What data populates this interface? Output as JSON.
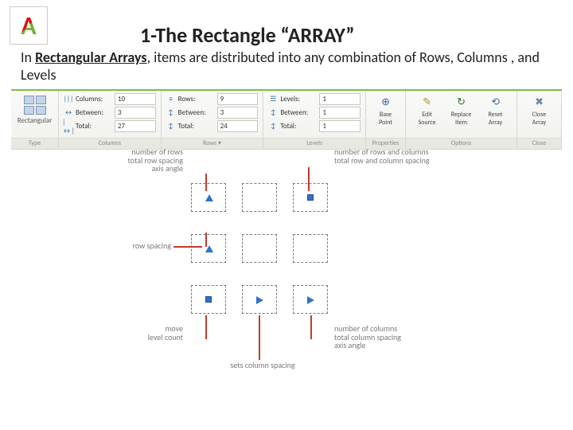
{
  "header": {
    "title": "1-The Rectangle “ARRAY”",
    "desc_prefix": "In ",
    "desc_bold": "Rectangular Arrays",
    "desc_rest": ", items are distributed into any combination of Rows, Columns , and Levels"
  },
  "ribbon": {
    "type": {
      "label": "Rectangular",
      "panel": "Type"
    },
    "columns": {
      "panel": "Columns",
      "rows": [
        {
          "icon": "|||",
          "label": "Columns:",
          "value": "10"
        },
        {
          "icon": "↔",
          "label": "Between:",
          "value": "3"
        },
        {
          "icon": "|↔|",
          "label": "Total:",
          "value": "27"
        }
      ]
    },
    "rowsP": {
      "panel": "Rows ▾",
      "rows": [
        {
          "icon": "≡",
          "label": "Rows:",
          "value": "9"
        },
        {
          "icon": "↕",
          "label": "Between:",
          "value": "3"
        },
        {
          "icon": "↕",
          "label": "Total:",
          "value": "24"
        }
      ]
    },
    "levels": {
      "panel": "Levels",
      "rows": [
        {
          "icon": "☰",
          "label": "Levels:",
          "value": "1"
        },
        {
          "icon": "↕",
          "label": "Between:",
          "value": "1"
        },
        {
          "icon": "↕",
          "label": "Total:",
          "value": "1"
        }
      ]
    },
    "props": {
      "panel": "Properties",
      "items": [
        {
          "icon": "⊕",
          "label1": "Base",
          "label2": "Point"
        }
      ]
    },
    "options": {
      "panel": "Options",
      "items": [
        {
          "icon": "✎",
          "label1": "Edit",
          "label2": "Source"
        },
        {
          "icon": "↻",
          "label1": "Replace",
          "label2": "Item"
        },
        {
          "icon": "⟲",
          "label1": "Reset",
          "label2": "Array"
        }
      ]
    },
    "close": {
      "panel": "Close",
      "items": [
        {
          "icon": "✖",
          "label1": "Close",
          "label2": "Array"
        }
      ]
    }
  },
  "annotations": {
    "top_left": "number of rows\ntotal row spacing\naxis angle",
    "top_right": "number of rows and columns\ntotal row and column spacing",
    "mid_left": "row spacing",
    "bot_left": "move\nlevel count",
    "bot_mid": "sets column spacing",
    "bot_right": "number of columns\ntotal column spacing\naxis angle"
  }
}
